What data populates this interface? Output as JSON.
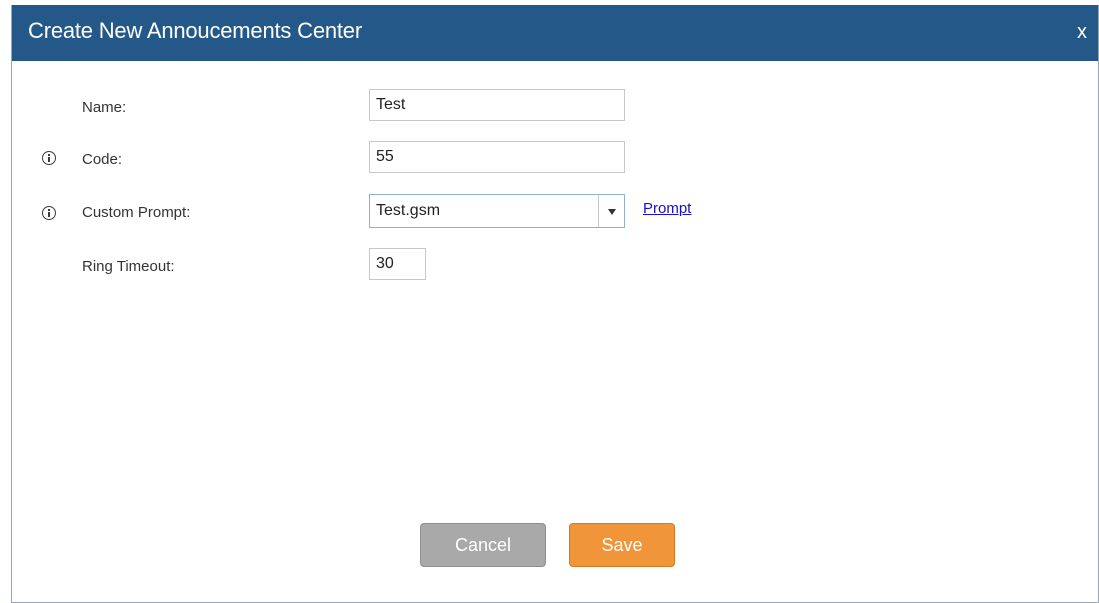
{
  "dialog": {
    "title": "Create New Annoucements Center",
    "close_label": "x"
  },
  "form": {
    "name": {
      "label": "Name:",
      "value": "Test",
      "info_icon": false
    },
    "code": {
      "label": "Code:",
      "value": "55",
      "info_icon": true
    },
    "custom_prompt": {
      "label": "Custom Prompt:",
      "selected": "Test.gsm",
      "link_label": "Prompt",
      "info_icon": true
    },
    "ring_timeout": {
      "label": "Ring Timeout:",
      "value": "30",
      "info_icon": false
    }
  },
  "buttons": {
    "cancel_label": "Cancel",
    "save_label": "Save"
  },
  "colors": {
    "titlebar": "#245888",
    "save": "#f0953a",
    "cancel": "#a9a9a9",
    "link": "#1a0dcc"
  },
  "icons": {
    "info": "info-circle-icon",
    "dropdown": "triangle-down-icon"
  }
}
